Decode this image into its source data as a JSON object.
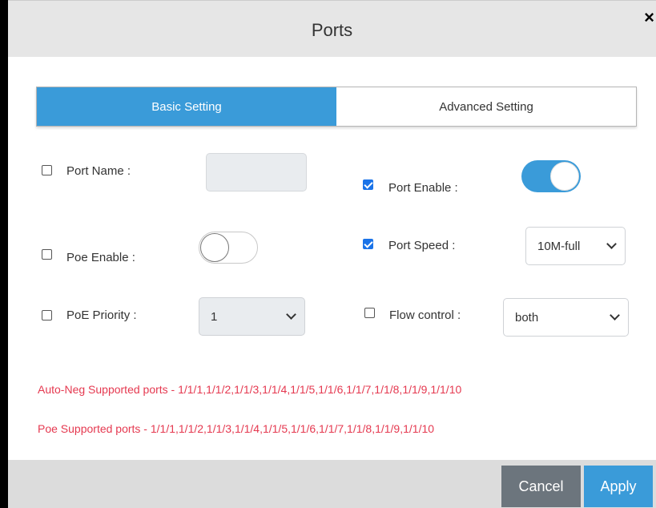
{
  "dialog": {
    "title": "Ports",
    "close_symbol": "×"
  },
  "tabs": [
    {
      "label": "Basic Setting",
      "active": true
    },
    {
      "label": "Advanced Setting",
      "active": false
    }
  ],
  "fields": {
    "port_name": {
      "label": "Port Name :",
      "checked": false,
      "value": ""
    },
    "port_enable": {
      "label": "Port Enable :",
      "checked": true,
      "toggle_on": true
    },
    "poe_enable": {
      "label": "Poe Enable :",
      "checked": false,
      "toggle_on": false
    },
    "port_speed": {
      "label": "Port Speed :",
      "checked": true,
      "selected": "10M-full"
    },
    "poe_priority": {
      "label": "PoE Priority :",
      "checked": false,
      "selected": "1"
    },
    "flow_control": {
      "label": "Flow control :",
      "checked": false,
      "selected": "both"
    }
  },
  "info": {
    "auto_neg": "Auto-Neg Supported ports - 1/1/1,1/1/2,1/1/3,1/1/4,1/1/5,1/1/6,1/1/7,1/1/8,1/1/9,1/1/10",
    "poe": "Poe Supported ports - 1/1/1,1/1/2,1/1/3,1/1/4,1/1/5,1/1/6,1/1/7,1/1/8,1/1/9,1/1/10"
  },
  "footer": {
    "cancel_label": "Cancel",
    "apply_label": "Apply"
  },
  "colors": {
    "accent": "#3a9bd9",
    "error_text": "#e53950",
    "cancel_bg": "#6c757d"
  }
}
